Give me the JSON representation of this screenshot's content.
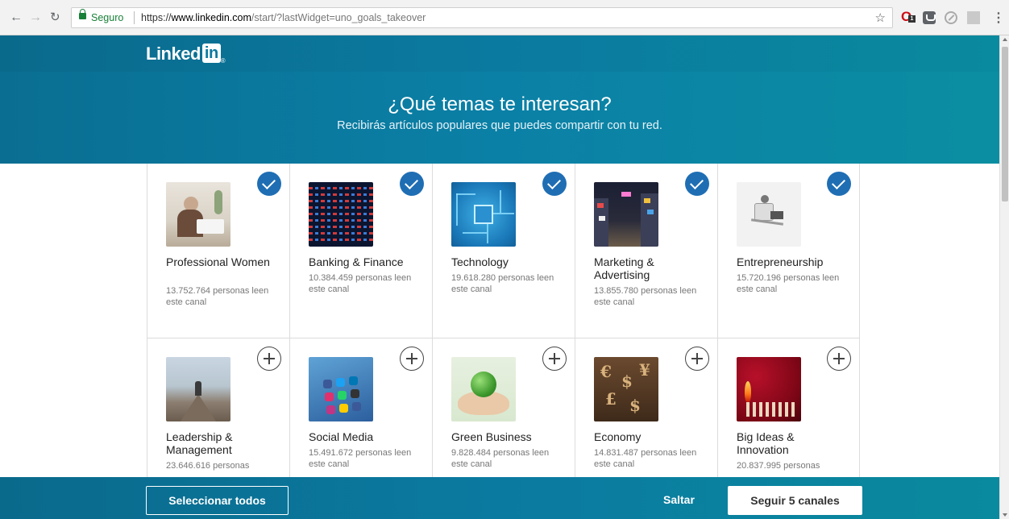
{
  "browser": {
    "secure_label": "Seguro",
    "url_scheme": "https://",
    "url_host": "www.linkedin.com",
    "url_path": "/start/?lastWidget=uno_goals_takeover",
    "extension_badge": "1"
  },
  "header": {
    "logo_text": "Linked",
    "logo_box": "in",
    "logo_mark": "®"
  },
  "hero": {
    "title": "¿Qué temas te interesan?",
    "subtitle": "Recibirás artículos populares que puedes compartir con tu red."
  },
  "channels": [
    {
      "title": "Professional Women",
      "readers": "13.752.764 personas leen este canal",
      "selected": true,
      "image": "woman-laptop-image"
    },
    {
      "title": "Banking & Finance",
      "readers": "10.384.459 personas leen este canal",
      "selected": true,
      "image": "stock-board-image"
    },
    {
      "title": "Technology",
      "readers": "19.618.280 personas leen este canal",
      "selected": true,
      "image": "circuit-board-image"
    },
    {
      "title": "Marketing & Advertising",
      "readers": "13.855.780 personas leen este canal",
      "selected": true,
      "image": "city-billboards-image"
    },
    {
      "title": "Entrepreneurship",
      "readers": "15.720.196 personas leen este canal",
      "selected": true,
      "image": "man-chair-laptop-image"
    },
    {
      "title": "Leadership & Management",
      "readers": "23.646.616 personas",
      "selected": false,
      "image": "mountain-summit-image"
    },
    {
      "title": "Social Media",
      "readers": "15.491.672 personas leen este canal",
      "selected": false,
      "image": "phone-apps-image"
    },
    {
      "title": "Green Business",
      "readers": "9.828.484 personas leen este canal",
      "selected": false,
      "image": "globe-hands-image"
    },
    {
      "title": "Economy",
      "readers": "14.831.487 personas leen este canal",
      "selected": false,
      "image": "currency-symbols-image"
    },
    {
      "title": "Big Ideas & Innovation",
      "readers": "20.837.995 personas",
      "selected": false,
      "image": "matches-image"
    }
  ],
  "footer": {
    "select_all": "Seleccionar todos",
    "skip": "Saltar",
    "follow": "Seguir 5 canales"
  },
  "colors": {
    "brand": "#0b7aa0",
    "check": "#1f6eb4"
  }
}
